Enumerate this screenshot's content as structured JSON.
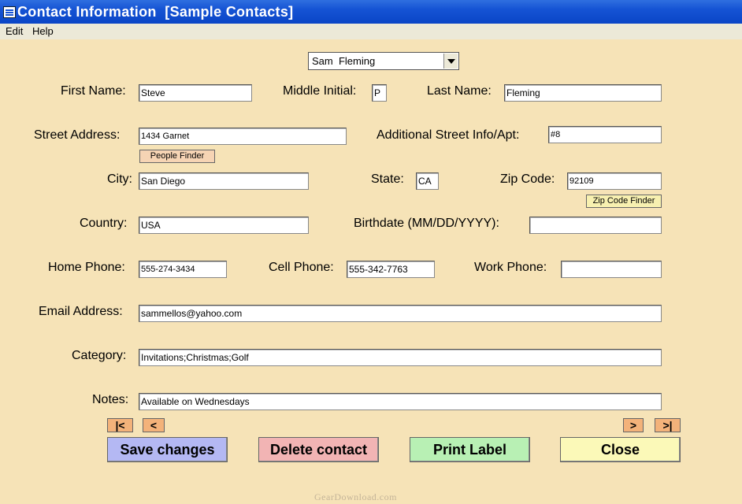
{
  "window": {
    "title": "Contact Information  [Sample Contacts]"
  },
  "menu": {
    "edit": "Edit",
    "help": "Help"
  },
  "contact_selector": {
    "selected": "Sam  Fleming"
  },
  "labels": {
    "first_name": "First Name:",
    "middle_initial": "Middle Initial:",
    "last_name": "Last Name:",
    "street": "Street Address:",
    "additional_street": "Additional Street Info/Apt:",
    "city": "City:",
    "state": "State:",
    "zip": "Zip Code:",
    "country": "Country:",
    "birthdate": "Birthdate (MM/DD/YYYY):",
    "home_phone": "Home Phone:",
    "cell_phone": "Cell Phone:",
    "work_phone": "Work Phone:",
    "email": "Email Address:",
    "category": "Category:",
    "notes": "Notes:"
  },
  "values": {
    "first_name": "Steve",
    "middle_initial": "P",
    "last_name": "Fleming",
    "street": "1434 Garnet",
    "additional_street": "#8",
    "city": "San Diego",
    "state": "CA",
    "zip": "92109",
    "country": "USA",
    "birthdate": "",
    "home_phone": "555-274-3434",
    "cell_phone": "555-342-7763",
    "work_phone": "",
    "email": "sammellos@yahoo.com",
    "category": "Invitations;Christmas;Golf",
    "notes": "Available on Wednesdays"
  },
  "buttons": {
    "people_finder": "People Finder",
    "zip_finder": "Zip Code Finder",
    "first": "|<",
    "prev": "<",
    "next": ">",
    "last": ">|",
    "save": "Save changes",
    "delete": "Delete contact",
    "print": "Print Label",
    "close": "Close"
  },
  "colors": {
    "background": "#f6e3b7",
    "save": "#b4b8f3",
    "delete": "#f2b4b4",
    "print": "#b8f0b4",
    "close": "#fbf9b8",
    "nav": "#f3b27a",
    "people_finder": "#f6d4b4",
    "zip_finder": "#f7f0b0"
  },
  "watermark": "GearDownload.com"
}
